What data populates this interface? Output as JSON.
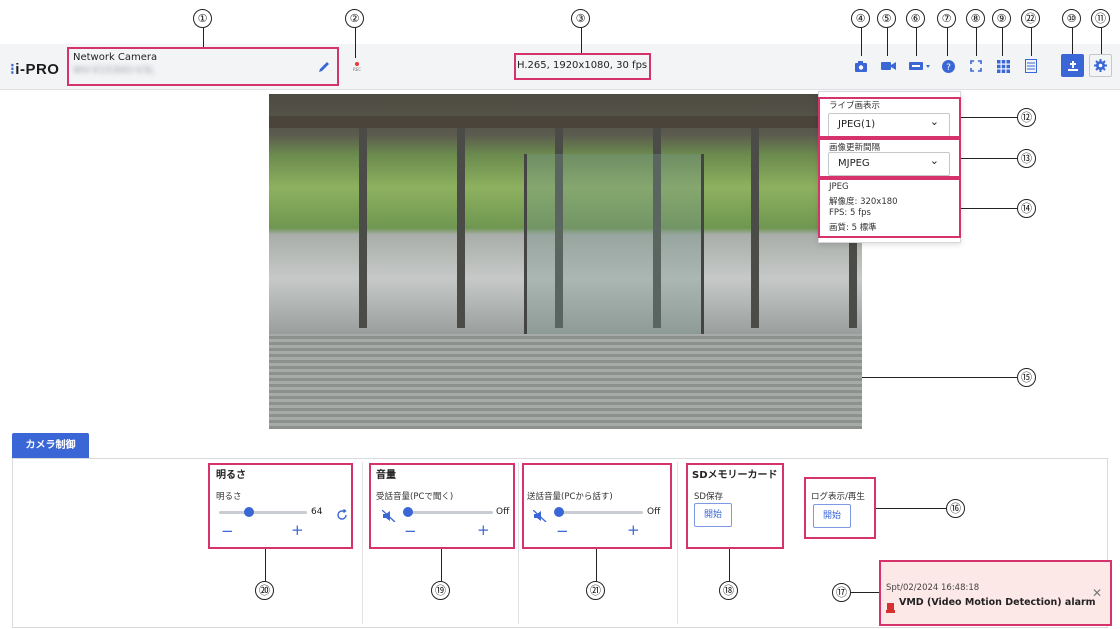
{
  "callouts": [
    "①",
    "②",
    "③",
    "④",
    "⑤",
    "⑥",
    "⑦",
    "⑧",
    "⑨",
    "㉒",
    "⑩",
    "⑪",
    "⑫",
    "⑬",
    "⑭",
    "⑮",
    "⑯",
    "⑰",
    "⑱",
    "⑲",
    "⑳",
    "㉑"
  ],
  "header": {
    "logo": "i-PRO",
    "camera_type": "Network Camera",
    "camera_model": "WV-X1530O-V3L",
    "stream_info": "H.265, 1920x1080, 30 fps",
    "rec_label": "REC"
  },
  "live_panel": {
    "display_label": "ライブ画表示",
    "display_value": "JPEG(1)",
    "refresh_label": "画像更新間隔",
    "refresh_value": "MJPEG",
    "info_title": "JPEG",
    "info_resolution": "解像度: 320x180",
    "info_fps": "FPS: 5 fps",
    "info_quality": "画質: 5 標準"
  },
  "tab_label": "カメラ制御",
  "brightness": {
    "title": "明るさ",
    "label": "明るさ",
    "value": "64",
    "level_fraction": 0.34
  },
  "audio_in": {
    "title": "音量",
    "label": "受話音量(PCで聞く)",
    "value": "Off"
  },
  "audio_out": {
    "label": "送話音量(PCから話す)",
    "value": "Off"
  },
  "sd": {
    "title": "SDメモリーカード",
    "label": "SD保存",
    "button": "開始"
  },
  "log": {
    "label": "ログ表示/再生",
    "button": "開始"
  },
  "alarm": {
    "timestamp": "Spt/02/2024 16:48:18",
    "message": "VMD (Video Motion Detection) alarm"
  },
  "symbols": {
    "minus": "−",
    "plus": "+",
    "close": "✕",
    "chevron": "⌄"
  },
  "colors": {
    "accent": "#3b66d6",
    "highlight": "#d6336c",
    "alarm_bg": "#fde8e8"
  }
}
